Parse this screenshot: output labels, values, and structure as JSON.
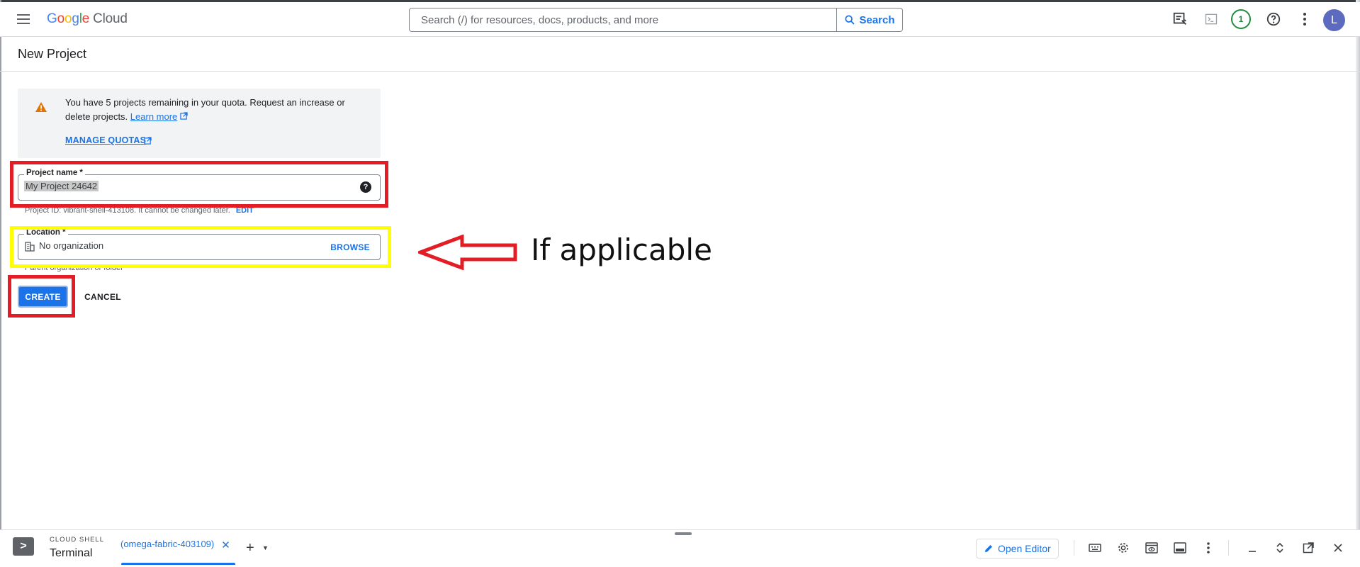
{
  "app": {
    "logo_letters": [
      "G",
      "o",
      "o",
      "g",
      "l",
      "e"
    ],
    "logo_product": "Cloud"
  },
  "topbar": {
    "search_placeholder": "Search (/) for resources, docs, products, and more",
    "search_button": "Search",
    "notification_count": "1",
    "avatar_letter": "L",
    "icons": [
      "menu-icon",
      "notes-icon",
      "terminal-icon",
      "help-icon",
      "more-vert-icon"
    ]
  },
  "page": {
    "title": "New Project"
  },
  "quota_banner": {
    "text": "You have 5 projects remaining in your quota. Request an increase or delete projects.",
    "learn_more": "Learn more",
    "manage_quotas": "MANAGE QUOTAS"
  },
  "form": {
    "project_name_label": "Project name *",
    "project_name_value": "My Project 24642",
    "project_id_hint": "Project ID: vibrant-shell-413108. It cannot be changed later.",
    "edit_label": "EDIT",
    "location_label": "Location *",
    "location_value": "No organization",
    "browse_label": "BROWSE",
    "location_hint": "Parent organization or folder",
    "create_label": "CREATE",
    "cancel_label": "CANCEL"
  },
  "annotation": {
    "text": "If applicable",
    "red_color": "#e31d25",
    "yellow_color": "#ffff00"
  },
  "cloud_shell": {
    "section_label": "CLOUD SHELL",
    "terminal_label": "Terminal",
    "tab_label": "(omega-fabric-403109)",
    "open_editor_label": "Open Editor"
  },
  "colors": {
    "accent": "#1a73e8",
    "badge_green": "#1e8e3e",
    "avatar_bg": "#5c6bc0"
  }
}
